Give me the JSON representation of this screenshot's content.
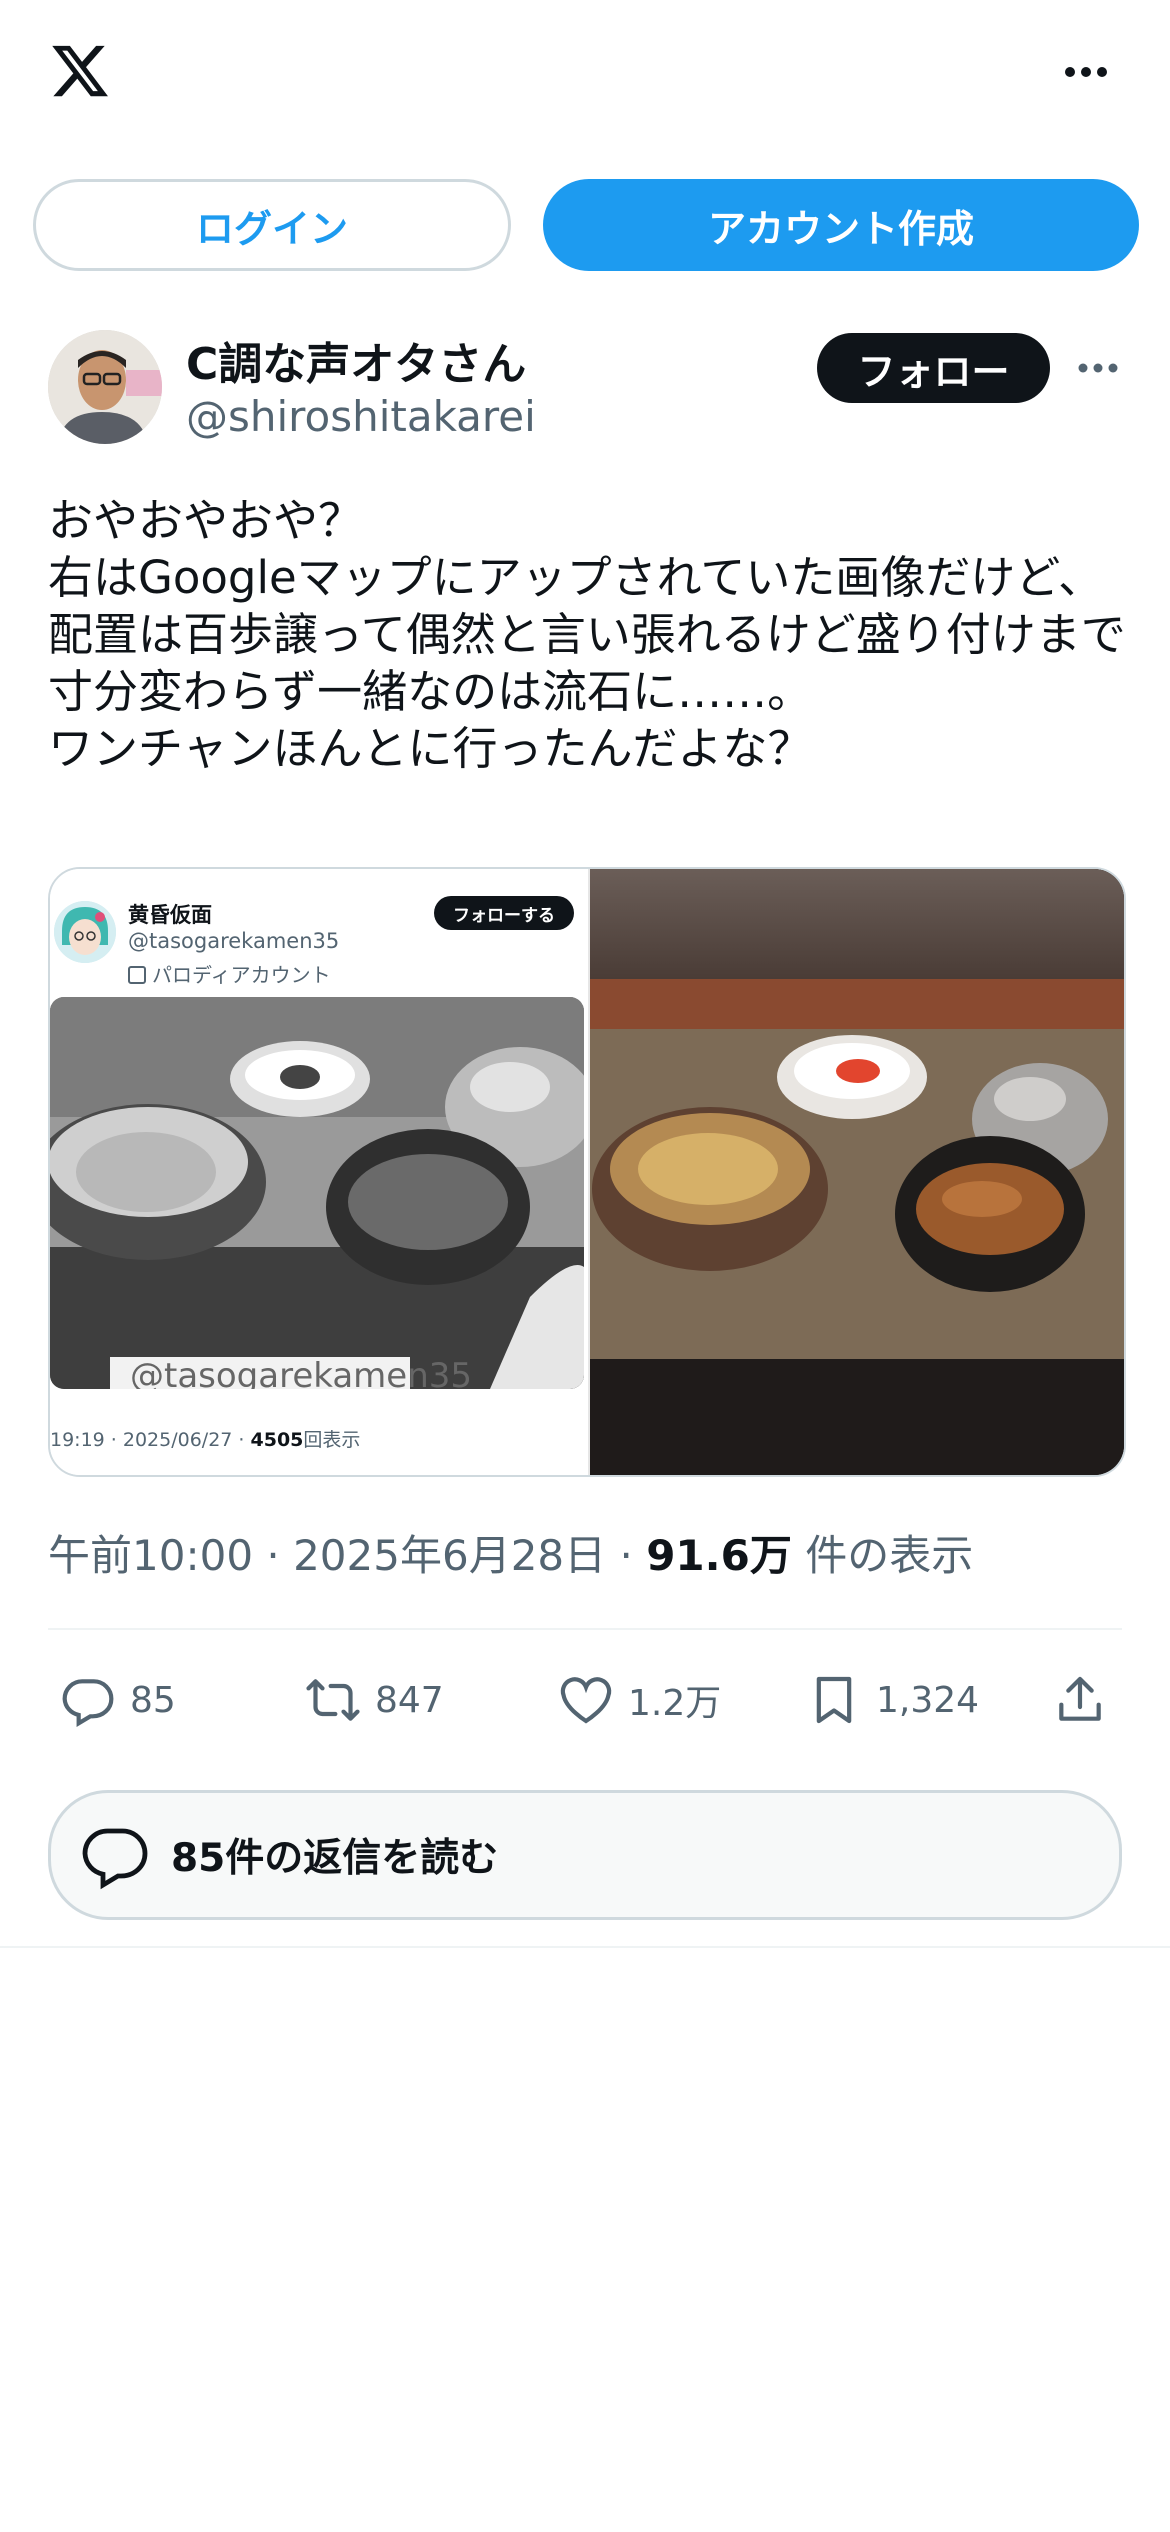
{
  "header": {
    "login_label": "ログイン",
    "signup_label": "アカウント作成"
  },
  "author": {
    "name": "C調な声オタさん",
    "handle": "@shiroshitakarei",
    "follow_label": "フォロー"
  },
  "tweet": {
    "text": "おやおやおや？\n右はGoogleマップにアップされていた画像だけど、配置は百歩譲って偶然と言い張れるけど盛り付けまで寸分変わらず一緒なのは流石に……。\nワンチャンほんとに行ったんだよな？"
  },
  "quoted": {
    "name": "黄昏仮面",
    "handle": "@tasogarekamen35",
    "label": "パロディアカウント",
    "follow_label": "フォローする",
    "watermark": "@tasogarekamen35",
    "time": "19:19 · 2025/06/27 · ",
    "views": "4505",
    "views_suffix": "回表示"
  },
  "meta": {
    "time": "午前10:00 · 2025年6月28日 · ",
    "views": "91.6万",
    "views_suffix": " 件の表示"
  },
  "actions": {
    "replies": "85",
    "retweets": "847",
    "likes": "1.2万",
    "bookmarks": "1,324"
  },
  "read_replies_label": "85件の返信を読む",
  "colors": {
    "accent": "#1d9bf0",
    "text": "#0f1419",
    "secondary": "#536471",
    "border": "#cfd9de"
  }
}
